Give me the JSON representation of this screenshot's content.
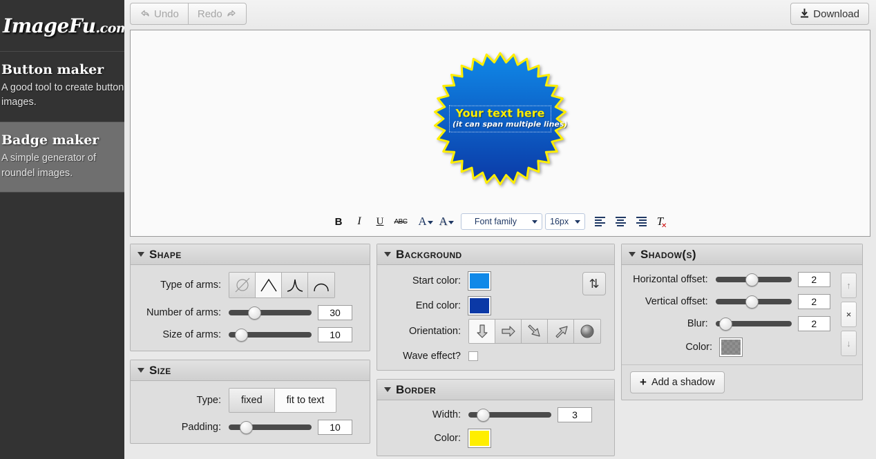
{
  "sidebar": {
    "logo": {
      "name": "ImageFu",
      "suffix": ".com"
    },
    "items": [
      {
        "title": "Button maker",
        "desc": "A good tool to create button images.",
        "active": false
      },
      {
        "title": "Badge maker",
        "desc": "A simple generator of roundel images.",
        "active": true
      }
    ]
  },
  "topbar": {
    "undo_label": "Undo",
    "redo_label": "Redo",
    "download_label": "Download"
  },
  "canvas": {
    "badge": {
      "line1": "Your text here",
      "line2": "(it can span multiple lines)",
      "start_color": "#1089e8",
      "end_color": "#0b39a6",
      "border_color": "#ffee00",
      "arms": 30
    }
  },
  "rte": {
    "bold": "B",
    "italic": "I",
    "underline": "U",
    "strikethrough": "ABC",
    "fore_color": "A",
    "back_color": "A",
    "font_family": "Font family",
    "font_size": "16px",
    "align_left": "align-left",
    "align_center": "align-center",
    "align_right": "align-right",
    "clear_format": "T"
  },
  "panels": {
    "shape": {
      "title": "Shape",
      "type_label": "Type of arms:",
      "arm_types": [
        "none-icon",
        "peak-icon",
        "concave-peak-icon",
        "dome-icon"
      ],
      "arm_type_selected": 1,
      "number_label": "Number of arms:",
      "number_value": "30",
      "number_pct": 28,
      "size_label": "Size of arms:",
      "size_value": "10",
      "size_pct": 9
    },
    "size": {
      "title": "Size",
      "type_label": "Type:",
      "type_options": [
        "fixed",
        "fit to text"
      ],
      "type_selected": 1,
      "padding_label": "Padding:",
      "padding_value": "10",
      "padding_pct": 16
    },
    "background": {
      "title": "Background",
      "start_label": "Start color:",
      "start_color": "#1089e8",
      "end_label": "End color:",
      "end_color": "#0b39a6",
      "swap_icon": "swap-colors-icon",
      "orientation_label": "Orientation:",
      "orientations": [
        "arrow-down-icon",
        "arrow-right-icon",
        "arrow-diagonal-down-icon",
        "arrow-diagonal-up-icon",
        "radial-icon"
      ],
      "orientation_selected": 0,
      "wave_label": "Wave effect?",
      "wave_checked": false
    },
    "border": {
      "title": "Border",
      "width_label": "Width:",
      "width_value": "3",
      "width_pct": 12,
      "color_label": "Color:",
      "color": "#ffee00"
    },
    "shadow": {
      "title": "Shadow(s)",
      "h_label": "Horizontal offset:",
      "h_value": "2",
      "h_pct": 48,
      "v_label": "Vertical offset:",
      "v_value": "2",
      "v_pct": 48,
      "blur_label": "Blur:",
      "blur_value": "2",
      "blur_pct": 6,
      "color_label": "Color:",
      "color": "rgba(90,90,90,0.62)",
      "move_up": "↑",
      "remove": "×",
      "move_down": "↓",
      "add_label": "Add a shadow"
    }
  }
}
